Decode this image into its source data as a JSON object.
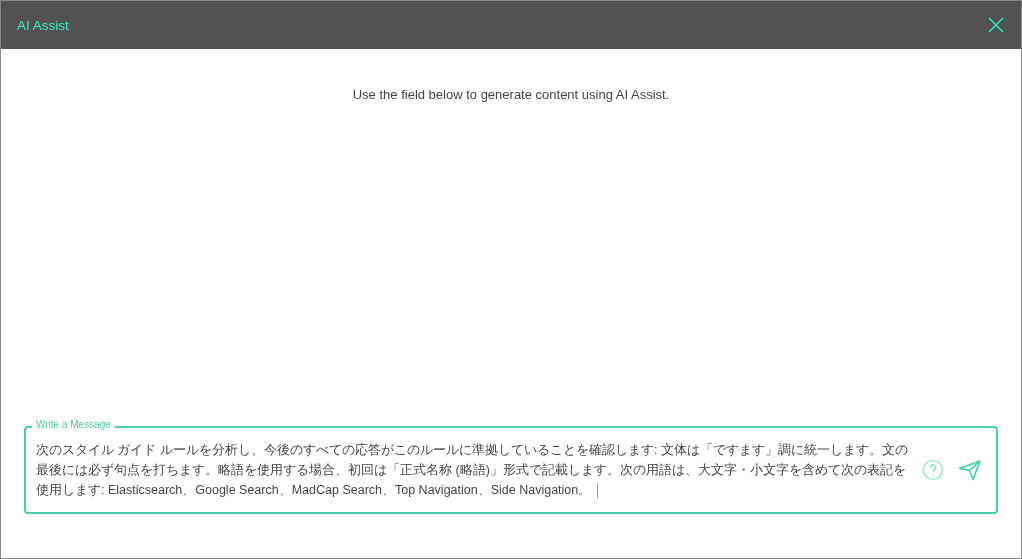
{
  "dialog": {
    "title": "AI Assist"
  },
  "intro": "Use the field below to generate content using AI Assist.",
  "message": {
    "label": "Write a Message",
    "value": "次のスタイル ガイド ルールを分析し、今後のすべての応答がこのルールに準拠していることを確認します: 文体は「ですます」調に統一します。文の最後には必ず句点を打ちます。略語を使用する場合、初回は「正式名称 (略語)」形式で記載します。次の用語は、大文字・小文字を含めて次の表記を使用します: Elasticsearch、Google Search、MadCap Search、Top Navigation、Side Navigation。"
  }
}
